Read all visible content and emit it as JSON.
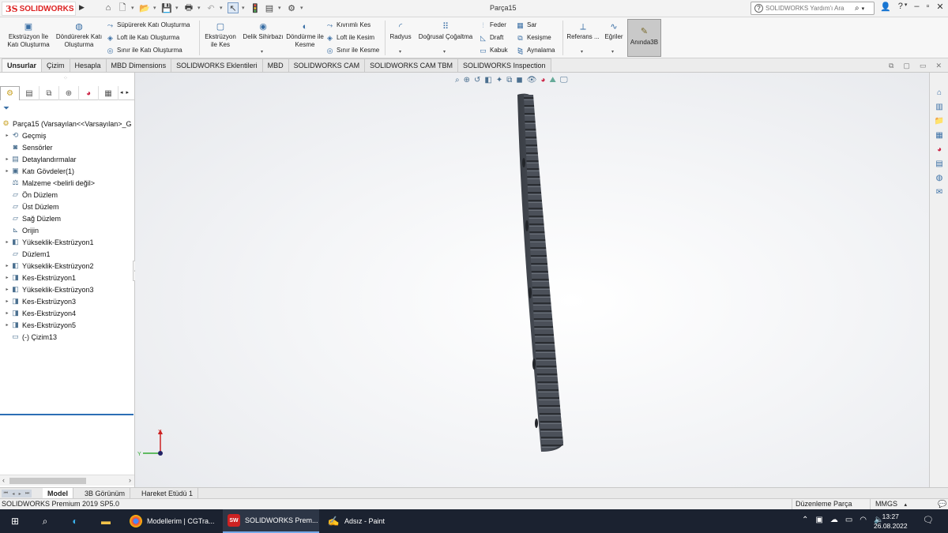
{
  "window": {
    "logo_ds": "3S",
    "logo_text": "SOLIDWORKS",
    "doc_title": "Parça15",
    "help_placeholder": "SOLIDWORKS Yardım'ı Ara",
    "icons": [
      "home-icon",
      "new-file-icon",
      "open-file-icon",
      "save-icon",
      "print-icon",
      "undo-icon",
      "select-icon",
      "rebuild-icon",
      "file-properties-icon",
      "options-gear-icon"
    ]
  },
  "ribbon": {
    "extrude_boss": "Ekstrüzyon İle Katı Oluşturma",
    "revolve_boss": "Döndürerek Katı Oluşturma",
    "sweep_boss": "Süpürerek Katı Oluşturma",
    "loft_boss": "Loft ile Katı Oluşturma",
    "boundary_boss": "Sınır ile Katı Oluşturma",
    "extrude_cut": "Ekstrüzyon ile Kes",
    "hole_wizard": "Delik Sihirbazı",
    "revolve_cut": "Döndürme ile Kesme",
    "swept_cut": "Kıvrımlı Kes",
    "loft_cut": "Loft ile Kesim",
    "boundary_cut": "Sınır ile Kesme",
    "fillet": "Radyus",
    "linear_pattern": "Doğrusal Çoğaltma",
    "rib": "Feder",
    "draft": "Draft",
    "shell": "Kabuk",
    "wrap": "Sar",
    "intersect": "Kesişme",
    "mirror": "Aynalama",
    "reference": "Referans ...",
    "curves": "Eğriler",
    "instant3d": "Anında3B"
  },
  "tabs": [
    "Unsurlar",
    "Çizim",
    "Hesapla",
    "MBD Dimensions",
    "SOLIDWORKS Eklentileri",
    "MBD",
    "SOLIDWORKS CAM",
    "SOLIDWORKS CAM TBM",
    "SOLIDWORKS Inspection"
  ],
  "active_tab": "Unsurlar",
  "tree": {
    "root": "Parça15  (Varsayılan<<Varsayılan>_G",
    "items": [
      {
        "label": "Geçmiş",
        "icon": "history-icon",
        "expandable": true
      },
      {
        "label": "Sensörler",
        "icon": "sensor-icon",
        "expandable": false
      },
      {
        "label": "Detaylandırmalar",
        "icon": "annotations-icon",
        "expandable": true
      },
      {
        "label": "Katı Gövdeler(1)",
        "icon": "solid-bodies-icon",
        "expandable": true
      },
      {
        "label": "Malzeme <belirli değil>",
        "icon": "material-icon",
        "expandable": false
      },
      {
        "label": "Ön Düzlem",
        "icon": "plane-icon",
        "expandable": false
      },
      {
        "label": "Üst Düzlem",
        "icon": "plane-icon",
        "expandable": false
      },
      {
        "label": "Sağ Düzlem",
        "icon": "plane-icon",
        "expandable": false
      },
      {
        "label": "Orijin",
        "icon": "origin-icon",
        "expandable": false
      },
      {
        "label": "Yükseklik-Ekstrüzyon1",
        "icon": "boss-extrude-icon",
        "expandable": true
      },
      {
        "label": "Düzlem1",
        "icon": "plane-icon",
        "expandable": false
      },
      {
        "label": "Yükseklik-Ekstrüzyon2",
        "icon": "boss-extrude-icon",
        "expandable": true
      },
      {
        "label": "Kes-Ekstrüzyon1",
        "icon": "cut-extrude-icon",
        "expandable": true
      },
      {
        "label": "Yükseklik-Ekstrüzyon3",
        "icon": "boss-extrude-icon",
        "expandable": true
      },
      {
        "label": "Kes-Ekstrüzyon3",
        "icon": "cut-extrude-icon",
        "expandable": true
      },
      {
        "label": "Kes-Ekstrüzyon4",
        "icon": "cut-extrude-icon",
        "expandable": true
      },
      {
        "label": "Kes-Ekstrüzyon5",
        "icon": "cut-extrude-icon",
        "expandable": true
      },
      {
        "label": "(-) Çizim13",
        "icon": "sketch-icon",
        "expandable": false
      }
    ]
  },
  "model_tabs": [
    "Model",
    "3B Görünüm",
    "Hareket Etüdü 1"
  ],
  "status": {
    "product": "SOLIDWORKS Premium 2019 SP5.0",
    "mode": "Düzenleme Parça",
    "units": "MMGS"
  },
  "taskbar": {
    "apps": [
      {
        "label": "Modellerim | CGTra...",
        "icon": "chrome-icon",
        "badge": ""
      },
      {
        "label": "SOLIDWORKS Prem...",
        "icon": "solidworks-icon",
        "badge": "SW"
      },
      {
        "label": "Adsız - Paint",
        "icon": "paint-icon",
        "badge": ""
      }
    ],
    "time": "13:27",
    "date": "26.08.2022"
  },
  "colors": {
    "accent": "#2c6fb5",
    "model": "#454a52",
    "taskbar": "#1b2230"
  }
}
